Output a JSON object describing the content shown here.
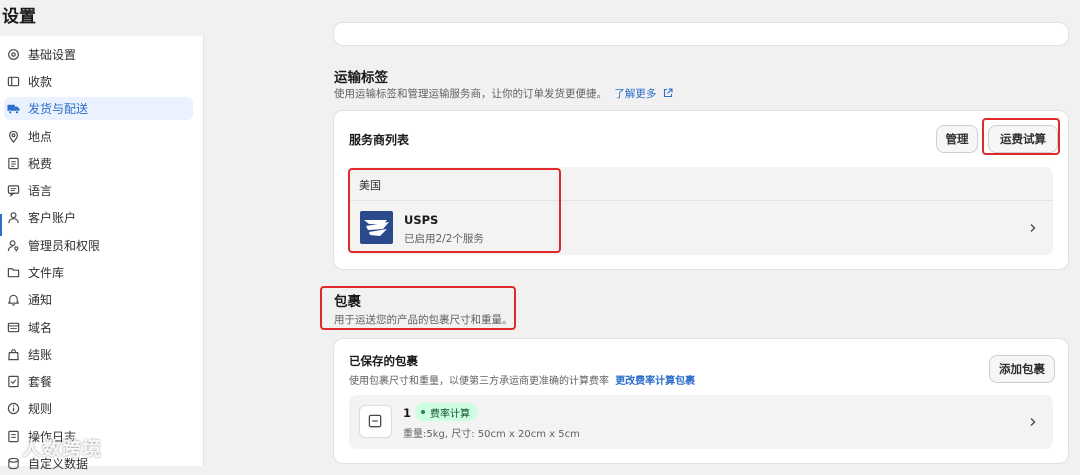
{
  "page": {
    "title": "设置"
  },
  "sidebar": {
    "items": [
      {
        "label": "基础设置",
        "icon": "store-settings-icon"
      },
      {
        "label": "收款",
        "icon": "payments-icon"
      },
      {
        "label": "发货与配送",
        "icon": "truck-icon",
        "active": true
      },
      {
        "label": "地点",
        "icon": "location-pin-icon"
      },
      {
        "label": "税费",
        "icon": "receipt-icon"
      },
      {
        "label": "语言",
        "icon": "language-icon"
      },
      {
        "label": "客户账户",
        "icon": "person-icon"
      },
      {
        "label": "管理员和权限",
        "icon": "user-key-icon"
      },
      {
        "label": "文件库",
        "icon": "folder-icon"
      },
      {
        "label": "通知",
        "icon": "bell-icon"
      },
      {
        "label": "域名",
        "icon": "domain-icon"
      },
      {
        "label": "结账",
        "icon": "bag-icon"
      },
      {
        "label": "套餐",
        "icon": "plan-icon"
      },
      {
        "label": "规则",
        "icon": "info-icon"
      },
      {
        "label": "操作日志",
        "icon": "log-icon"
      },
      {
        "label": "自定义数据",
        "icon": "data-icon"
      }
    ]
  },
  "shipping_labels": {
    "title": "运输标签",
    "description": "使用运输标签和管理运输服务商，让你的订单发货更便捷。",
    "learn_more": "了解更多",
    "card_title": "服务商列表",
    "manage_button": "管理",
    "estimate_button": "运费试算",
    "country": "美国",
    "carrier": {
      "name": "USPS",
      "status": "已启用2/2个服务",
      "logo": "usps-eagle-logo"
    }
  },
  "packages": {
    "title": "包裹",
    "description": "用于运送您的产品的包裹尺寸和重量。",
    "saved_title": "已保存的包裹",
    "saved_desc": "使用包裹尺寸和重量，以便第三方承运商更准确的计算费率",
    "saved_link": "更改费率计算包裹",
    "add_button": "添加包裹",
    "item": {
      "name": "1",
      "badge": "费率计算",
      "details": "重量:5kg, 尺寸: 50cm x 20cm x 5cm"
    }
  },
  "watermark": {
    "text": "人数跨境"
  },
  "colors": {
    "accent": "#2c6ecb",
    "highlight_box": "#e02a2a",
    "badge_bg": "#cdfee1",
    "badge_fg": "#0c5132"
  }
}
